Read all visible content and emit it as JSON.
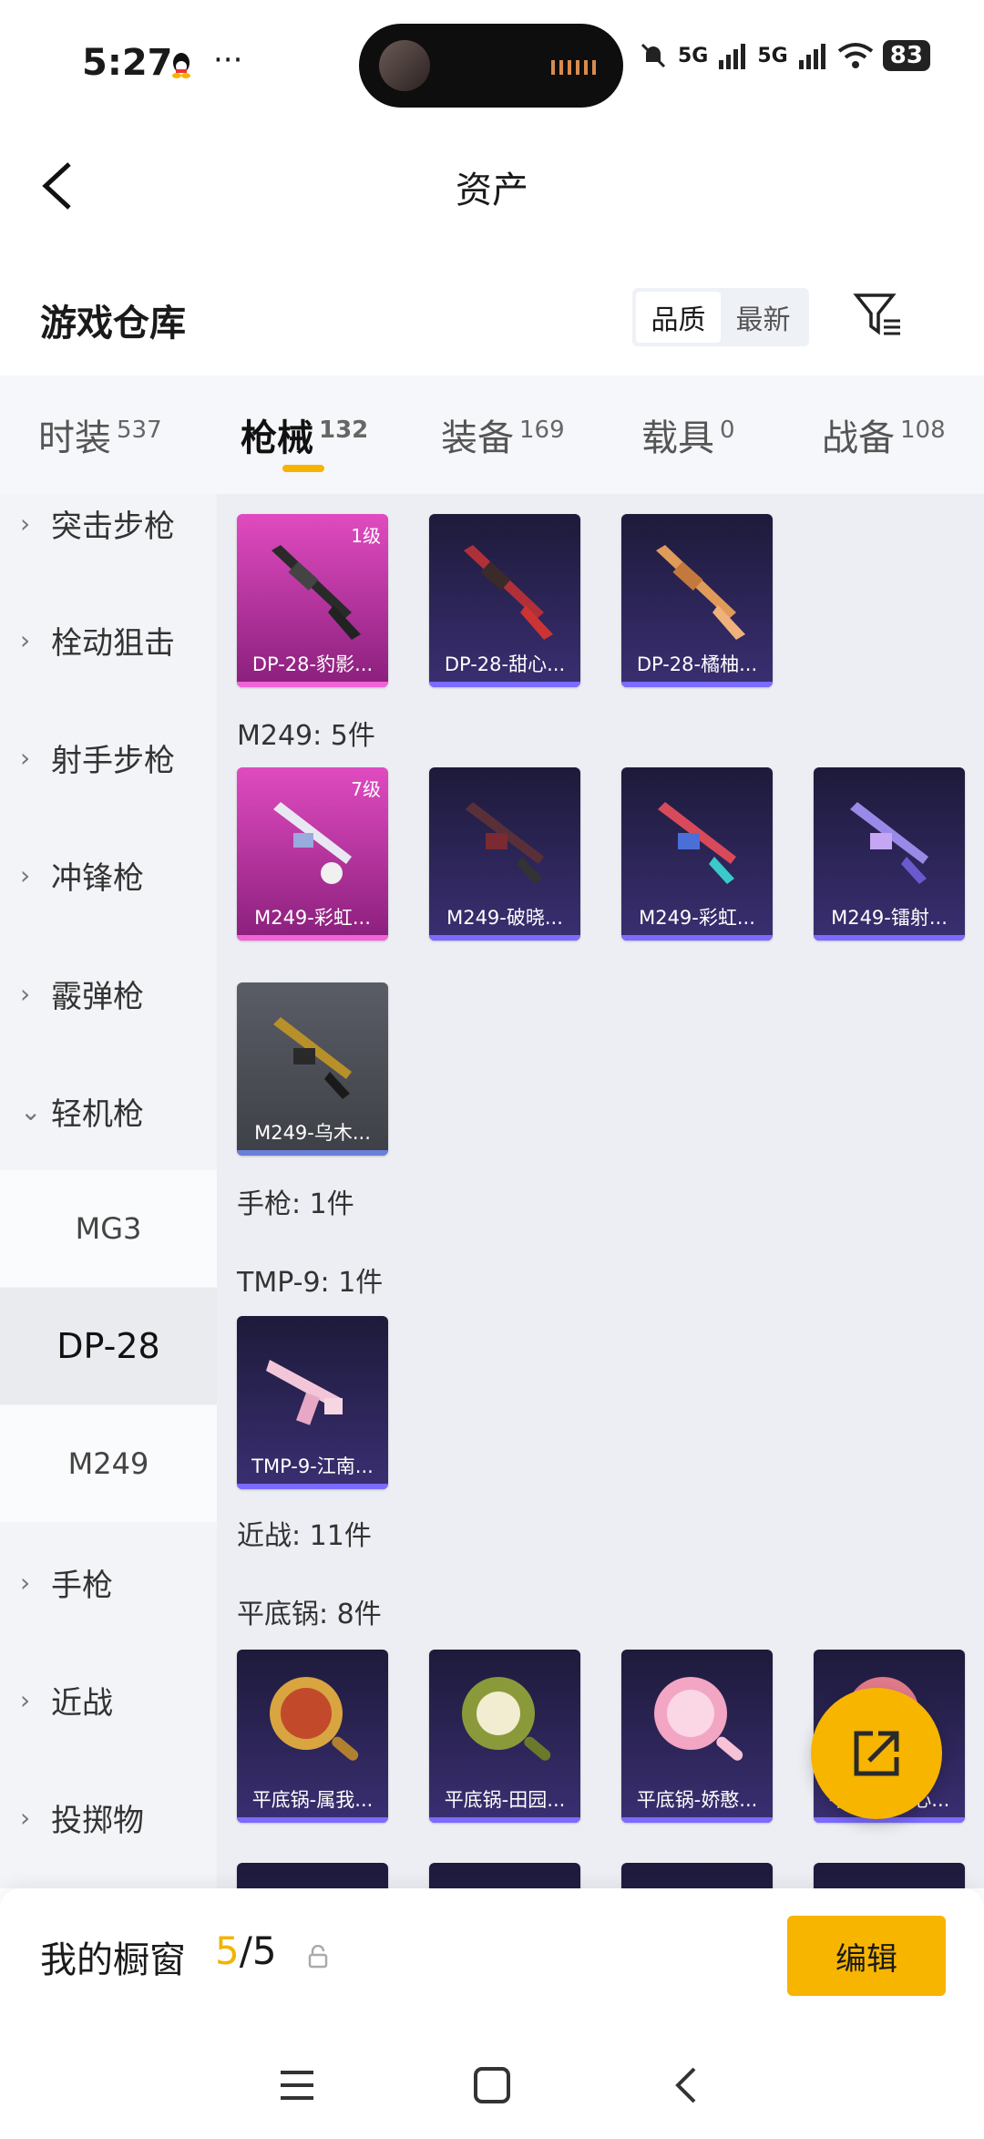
{
  "status": {
    "time": "5:27",
    "dots": "···",
    "signal1": "5G",
    "signal2": "5G",
    "battery": "83"
  },
  "header": {
    "title": "资产"
  },
  "warehouse": {
    "title": "游戏仓库",
    "sort_options": [
      "品质",
      "最新"
    ]
  },
  "tabs": [
    {
      "label": "时装",
      "count": "537"
    },
    {
      "label": "枪械",
      "count": "132"
    },
    {
      "label": "装备",
      "count": "169"
    },
    {
      "label": "载具",
      "count": "0"
    },
    {
      "label": "战备",
      "count": "108"
    }
  ],
  "sidebar": {
    "categories": [
      "突击步枪",
      "栓动狙击",
      "射手步枪",
      "冲锋枪",
      "霰弹枪",
      "轻机枪"
    ],
    "sub": [
      "MG3",
      "DP-28",
      "M249"
    ],
    "more": [
      "手枪",
      "近战",
      "投掷物"
    ]
  },
  "content": {
    "dp28": [
      {
        "name": "DP-28-豹影...",
        "level": "1级"
      },
      {
        "name": "DP-28-甜心..."
      },
      {
        "name": "DP-28-橘柚..."
      }
    ],
    "m249_label": "M249: 5件",
    "m249": [
      {
        "name": "M249-彩虹...",
        "level": "7级"
      },
      {
        "name": "M249-破晓..."
      },
      {
        "name": "M249-彩虹..."
      },
      {
        "name": "M249-镭射..."
      },
      {
        "name": "M249-乌木..."
      }
    ],
    "pistol_label": "手枪: 1件",
    "tmp_label": "TMP-9: 1件",
    "tmp": [
      {
        "name": "TMP-9-江南..."
      }
    ],
    "melee_label": "近战: 11件",
    "pan_label": "平底锅: 8件",
    "pans": [
      {
        "name": "平底锅-属我..."
      },
      {
        "name": "平底锅-田园..."
      },
      {
        "name": "平底锅-娇憨..."
      },
      {
        "name": "平底锅-甜心..."
      }
    ]
  },
  "showcase": {
    "title": "我的橱窗",
    "current": "5",
    "total": "/5",
    "edit_label": "编辑"
  }
}
